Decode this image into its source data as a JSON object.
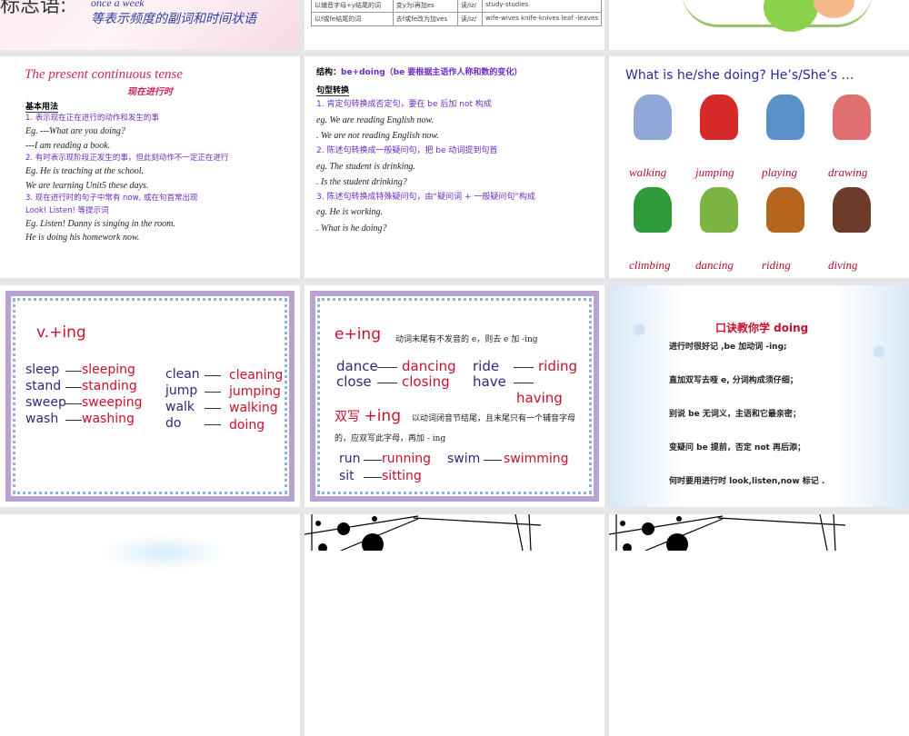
{
  "slide1": {
    "label": "标志语:",
    "freq": "once a week",
    "desc": "等表示频度的副词和时间状语"
  },
  "slide2": {
    "rows": [
      [
        "以辅音字母+y结尾的词",
        "变y为i再加es",
        "读/iz/",
        "study-studies"
      ],
      [
        "以f或fe结尾的词",
        "去f或fe改为加ves",
        "读/iz/",
        "wife-wives knife-knives leaf -leaves"
      ]
    ]
  },
  "slide4": {
    "title": "The present continuous tense",
    "subtitle": "现在进行时",
    "heading": "基本用法",
    "lines": [
      {
        "t": "1. 表示现在正在进行的动作和发生的事",
        "c": "purple"
      },
      {
        "t": "Eg. ---What are you doing?",
        "c": "dark"
      },
      {
        "t": "    ---I am reading a book.",
        "c": "dark"
      },
      {
        "t": "2. 有时表示现阶段正发生的事，但此刻动作不一定正在进行",
        "c": "purple"
      },
      {
        "t": "Eg. He is teaching at the school.",
        "c": "dark"
      },
      {
        "t": "    We are learning Unit5 these days.",
        "c": "dark"
      },
      {
        "t": "3. 现在进行时的句子中常有 now, 或在句首常出现",
        "c": "purple"
      },
      {
        "t": "Look! Listen! 等提示词",
        "c": "purple"
      },
      {
        "t": "Eg. Listen! Danny is singing in the room.",
        "c": "dark"
      },
      {
        "t": "    He is doing his homework now.",
        "c": "dark"
      }
    ]
  },
  "slide5": {
    "structure_label": "结构：",
    "structure": "be+doing（be 要根据主语作人称和数的变化）",
    "heading": "句型转换",
    "lines": [
      {
        "t": "1. 肯定句转换成否定句，要在 be 后加 not 构成",
        "c": "purple"
      },
      {
        "t": "eg. We are reading English now.",
        "c": "dark"
      },
      {
        "t": ". We are not reading English now.",
        "c": "dark"
      },
      {
        "t": "2. 陈述句转换成一般疑问句，把 be 动词提到句首",
        "c": "purple"
      },
      {
        "t": "eg. The student is drinking.",
        "c": "dark"
      },
      {
        "t": ". Is the student drinking?",
        "c": "dark"
      },
      {
        "t": "3. 陈述句转换成特殊疑问句，由“疑问词 + 一般疑问句”构成",
        "c": "purple"
      },
      {
        "t": "eg. He is working.",
        "c": "dark"
      },
      {
        "t": ". What is he doing?",
        "c": "dark"
      }
    ]
  },
  "slide6": {
    "title": "What is he/she doing? He’s/She’s …",
    "labels": [
      "walking",
      "jumping",
      "playing",
      "drawing",
      "climbing",
      "dancing",
      "riding",
      "diving"
    ],
    "colors": [
      "#8fa8d8",
      "#d42a2a",
      "#5a8fc8",
      "#e07070",
      "#2e9a3a",
      "#7cb342",
      "#b5651d",
      "#6d3b2a"
    ]
  },
  "slide7": {
    "title": "v.+ing",
    "left": [
      [
        "sleep",
        "sleeping"
      ],
      [
        "stand",
        "standing"
      ],
      [
        "sweep",
        "sweeping"
      ],
      [
        "wash",
        "washing"
      ]
    ],
    "right": [
      [
        "clean",
        "cleaning"
      ],
      [
        "jump",
        "jumping"
      ],
      [
        "walk",
        "walking"
      ],
      [
        "do",
        "doing"
      ]
    ]
  },
  "slide8": {
    "rule1": "e+ing",
    "rule1_desc": "动词末尾有不发音的 e，则去 e 加 -ing",
    "pairs1": [
      [
        "dance",
        "dancing"
      ],
      [
        "close",
        "closing"
      ],
      [
        "ride",
        "riding"
      ],
      [
        "have",
        "having"
      ]
    ],
    "rule2_a": "双写",
    "rule2_b": "+ing",
    "rule2_desc": "以动词闭音节结尾，且末尾只有一个辅音字母的，应双写此字母，再加 - ing",
    "pairs2": [
      [
        "run",
        "running"
      ],
      [
        "swim",
        "swimming"
      ],
      [
        "sit",
        "sitting"
      ]
    ]
  },
  "slide9": {
    "title": "口诀教你学 doing",
    "lines": [
      "进行时很好记 ,be 加动词 -ing;",
      "直加双写去哑 e, 分词构成须仔细；",
      "别说 be 无词义，主语和它最亲密；",
      "变疑问 be 提前，否定 not 再后添；",
      "何时要用进行时 look,listen,now 标记 ."
    ]
  }
}
